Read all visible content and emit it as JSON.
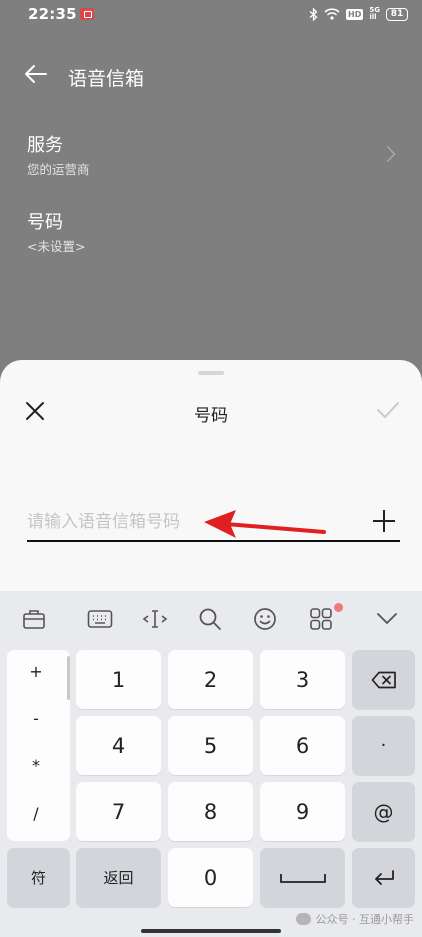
{
  "status_bar": {
    "time": "22:35",
    "hd_label": "HD",
    "network_top": "5G",
    "network_bottom": "ill",
    "battery": "81"
  },
  "page": {
    "title": "语音信箱",
    "rows": [
      {
        "title": "服务",
        "subtitle": "您的运营商"
      },
      {
        "title": "号码",
        "subtitle": "<未设置>"
      }
    ]
  },
  "sheet": {
    "title": "号码",
    "input_placeholder": "请输入语音信箱号码",
    "input_value": ""
  },
  "keyboard": {
    "toolbar": [
      "briefcase-icon",
      "keyboard-icon",
      "cursor-move-icon",
      "search-icon",
      "emoji-icon",
      "apps-icon",
      "chevron-down-icon"
    ],
    "symbols": [
      "+",
      "-",
      "*",
      "/"
    ],
    "digits": [
      "1",
      "2",
      "3",
      "4",
      "5",
      "6",
      "7",
      "8",
      "9",
      "0"
    ],
    "dot": "·",
    "at": "@",
    "fu": "符",
    "fanhui": "返回"
  },
  "watermark": "公众号 · 互通小帮手",
  "colors": {
    "overlay": "#7f7f7f",
    "sheet_bg": "#f8f8f8",
    "keyboard_bg": "#e9eaee",
    "arrow": "#e02020",
    "notification_dot": "#f07a7a"
  }
}
